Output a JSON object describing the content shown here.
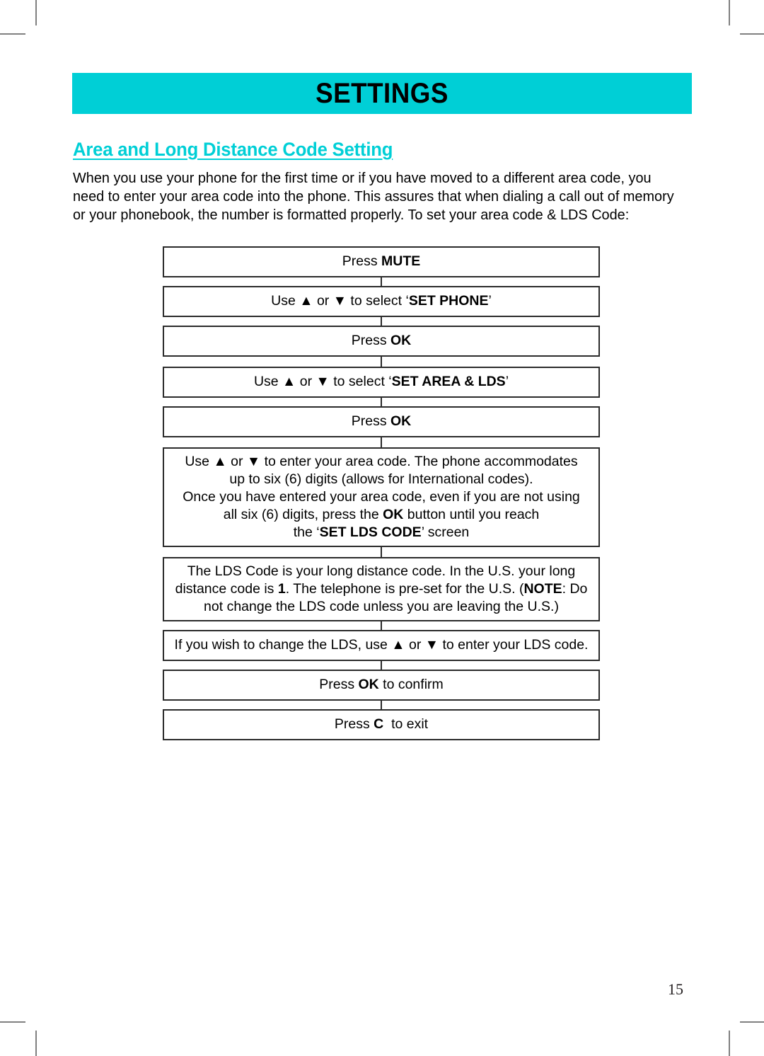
{
  "page": {
    "section_banner_title": "SETTINGS",
    "topic_heading": "Area and Long Distance Code Setting",
    "intro_paragraph": "When you use your phone for the first time or if you have moved to a different area code, you need to enter your area code into the phone. This assures that when dialing a call out of memory or your phonebook, the number is formatted properly. To set your area code & LDS Code:",
    "page_number": "15"
  },
  "colors": {
    "accent_teal": "#00CFD6",
    "box_border": "#2b2b2b",
    "text": "#000000",
    "crop_mark": "#808080"
  },
  "flowchart": {
    "steps": [
      {
        "id": "press-mute",
        "lines": [
          [
            {
              "t": "Press ",
              "b": false
            },
            {
              "t": "MUTE",
              "b": true
            }
          ]
        ]
      },
      {
        "id": "select-set-phone",
        "lines": [
          [
            {
              "t": "Use ▲ or ▼ to select ‘",
              "b": false
            },
            {
              "t": "SET PHONE",
              "b": true
            },
            {
              "t": "’",
              "b": false
            }
          ]
        ]
      },
      {
        "id": "press-ok-1",
        "lines": [
          [
            {
              "t": "Press ",
              "b": false
            },
            {
              "t": "OK",
              "b": true
            }
          ]
        ]
      },
      {
        "id": "select-set-area-lds",
        "lines": [
          [
            {
              "t": "Use ▲ or ▼ to select ‘",
              "b": false
            },
            {
              "t": "SET AREA & LDS",
              "b": true
            },
            {
              "t": "’",
              "b": false
            }
          ]
        ]
      },
      {
        "id": "press-ok-2",
        "lines": [
          [
            {
              "t": "Press ",
              "b": false
            },
            {
              "t": "OK",
              "b": true
            }
          ]
        ]
      },
      {
        "id": "enter-area-code",
        "lines": [
          [
            {
              "t": "Use ▲ or ▼ to enter your area code. The phone accommodates",
              "b": false
            }
          ],
          [
            {
              "t": "up to six (6) digits (allows for International codes).",
              "b": false
            }
          ],
          [
            {
              "t": "Once you have entered your area code, even if you are not using",
              "b": false
            }
          ],
          [
            {
              "t": "all six (6) digits, press the ",
              "b": false
            },
            {
              "t": "OK",
              "b": true
            },
            {
              "t": " button until you reach",
              "b": false
            }
          ],
          [
            {
              "t": "the ‘",
              "b": false
            },
            {
              "t": "SET LDS CODE",
              "b": true
            },
            {
              "t": "’ screen",
              "b": false
            }
          ]
        ]
      },
      {
        "id": "lds-code-info",
        "lines": [
          [
            {
              "t": "The LDS Code is your long distance code. In the U.S. your long",
              "b": false
            }
          ],
          [
            {
              "t": "distance code is ",
              "b": false
            },
            {
              "t": "1",
              "b": true
            },
            {
              "t": ". The telephone is pre-set for the U.S. (",
              "b": false
            },
            {
              "t": "NOTE",
              "b": true
            },
            {
              "t": ": Do",
              "b": false
            }
          ],
          [
            {
              "t": "not change the LDS code unless you are leaving the U.S.)",
              "b": false
            }
          ]
        ]
      },
      {
        "id": "change-lds",
        "lines": [
          [
            {
              "t": "If you wish to change the LDS, use ▲ or ▼ to enter your LDS code.",
              "b": false
            }
          ]
        ]
      },
      {
        "id": "press-ok-confirm",
        "lines": [
          [
            {
              "t": "Press ",
              "b": false
            },
            {
              "t": "OK",
              "b": true
            },
            {
              "t": " to confirm",
              "b": false
            }
          ]
        ]
      },
      {
        "id": "press-c-exit",
        "lines": [
          [
            {
              "t": "Press ",
              "b": false
            },
            {
              "t": "C",
              "b": true
            },
            {
              "t": "  to exit",
              "b": false
            }
          ]
        ]
      }
    ]
  }
}
